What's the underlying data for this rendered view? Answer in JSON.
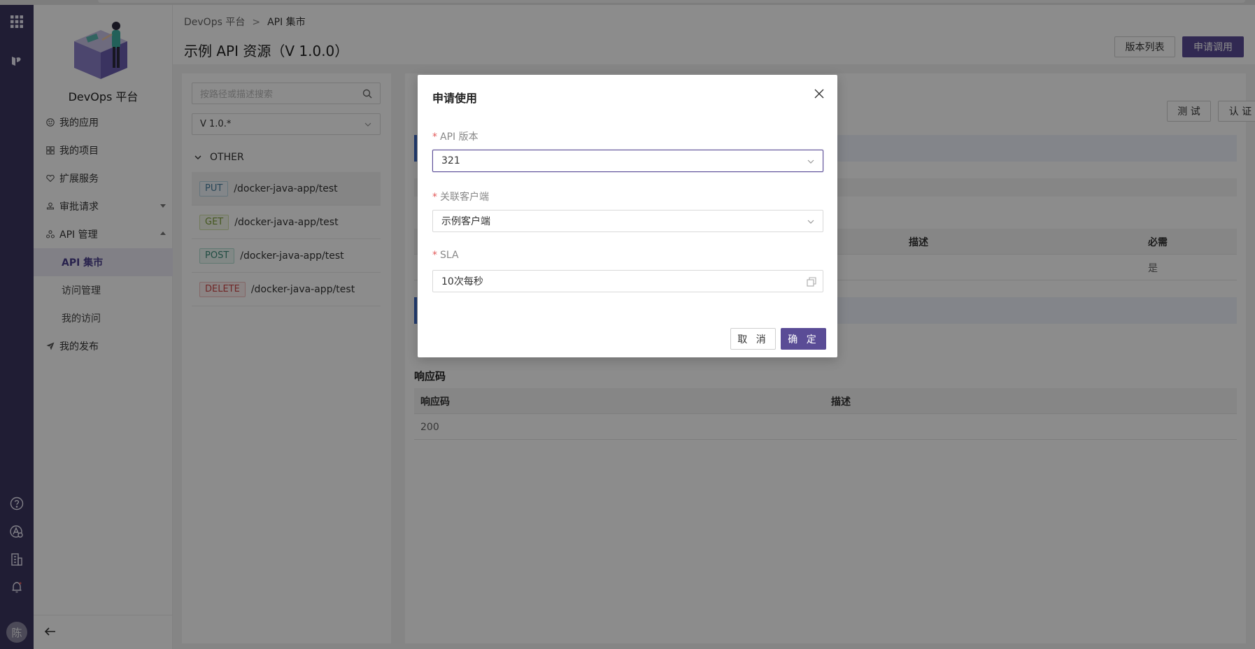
{
  "app": {
    "brand": "DevOps 平台",
    "avatar_initial": "陈"
  },
  "rail_icons": [
    "apps-grid-icon",
    "logo-mark-icon",
    "help-icon",
    "user-circle-icon",
    "building-icon",
    "bell-icon"
  ],
  "sidebar": {
    "items": [
      {
        "label": "我的应用",
        "icon": "smile-icon"
      },
      {
        "label": "我的项目",
        "icon": "grid-icon"
      },
      {
        "label": "扩展服务",
        "icon": "heart-icon"
      },
      {
        "label": "审批请求",
        "icon": "stamp-icon"
      },
      {
        "label": "API 管理",
        "icon": "cluster-icon"
      }
    ],
    "sub_items": [
      {
        "label": "API 集市"
      },
      {
        "label": "访问管理"
      },
      {
        "label": "我的访问"
      }
    ],
    "publish": {
      "label": "我的发布",
      "icon": "send-icon"
    }
  },
  "header": {
    "breadcrumb": [
      "DevOps 平台",
      "API 集市"
    ],
    "breadcrumb_sep": ">",
    "title": "示例 API 资源（V 1.0.0）",
    "btn_versions": "版本列表",
    "btn_apply": "申请调用"
  },
  "left_panel": {
    "search_placeholder": "按路径或描述搜索",
    "version": "V 1.0.*",
    "group": "OTHER",
    "apis": [
      {
        "method": "PUT",
        "path": "/docker-java-app/test"
      },
      {
        "method": "GET",
        "path": "/docker-java-app/test"
      },
      {
        "method": "POST",
        "path": "/docker-java-app/test"
      },
      {
        "method": "DELETE",
        "path": "/docker-java-app/test"
      }
    ]
  },
  "right_panel": {
    "btn_test": "测 试",
    "btn_auth": "认 证",
    "params_header": {
      "desc": "描述",
      "required": "必需"
    },
    "params_row": {
      "required": "是"
    },
    "response_title": "响应码",
    "response_header": {
      "code": "响应码",
      "desc": "描述"
    },
    "response_row": {
      "code": "200"
    }
  },
  "modal": {
    "title": "申请使用",
    "required_mark": "*",
    "api_version_label": "API 版本",
    "api_version_value": "321",
    "client_label": "关联客户端",
    "client_value": "示例客户端",
    "sla_label": "SLA",
    "sla_value": "10次每秒",
    "cancel": "取 消",
    "ok": "确 定"
  },
  "colors": {
    "rail": "#3b3560",
    "primary": "#5a4c96",
    "active_nav_bg": "#eceaf4",
    "required": "#e35b5b"
  }
}
